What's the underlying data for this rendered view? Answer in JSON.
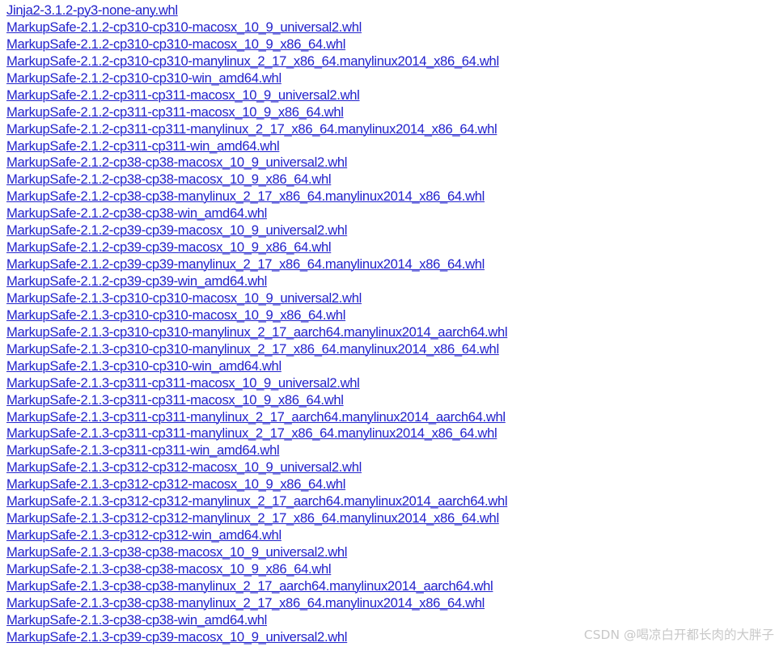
{
  "page": {
    "background_color": "#ffffff",
    "link_color": "#2222cc",
    "watermark_color": "#c8c8c8"
  },
  "watermark": {
    "text": "CSDN @喝凉白开都长肉的大胖子"
  },
  "file_index": {
    "items": [
      {
        "name": "Jinja2-3.1.2-py3-none-any.whl"
      },
      {
        "name": "MarkupSafe-2.1.2-cp310-cp310-macosx_10_9_universal2.whl"
      },
      {
        "name": "MarkupSafe-2.1.2-cp310-cp310-macosx_10_9_x86_64.whl"
      },
      {
        "name": "MarkupSafe-2.1.2-cp310-cp310-manylinux_2_17_x86_64.manylinux2014_x86_64.whl"
      },
      {
        "name": "MarkupSafe-2.1.2-cp310-cp310-win_amd64.whl"
      },
      {
        "name": "MarkupSafe-2.1.2-cp311-cp311-macosx_10_9_universal2.whl"
      },
      {
        "name": "MarkupSafe-2.1.2-cp311-cp311-macosx_10_9_x86_64.whl"
      },
      {
        "name": "MarkupSafe-2.1.2-cp311-cp311-manylinux_2_17_x86_64.manylinux2014_x86_64.whl"
      },
      {
        "name": "MarkupSafe-2.1.2-cp311-cp311-win_amd64.whl"
      },
      {
        "name": "MarkupSafe-2.1.2-cp38-cp38-macosx_10_9_universal2.whl"
      },
      {
        "name": "MarkupSafe-2.1.2-cp38-cp38-macosx_10_9_x86_64.whl"
      },
      {
        "name": "MarkupSafe-2.1.2-cp38-cp38-manylinux_2_17_x86_64.manylinux2014_x86_64.whl"
      },
      {
        "name": "MarkupSafe-2.1.2-cp38-cp38-win_amd64.whl"
      },
      {
        "name": "MarkupSafe-2.1.2-cp39-cp39-macosx_10_9_universal2.whl"
      },
      {
        "name": "MarkupSafe-2.1.2-cp39-cp39-macosx_10_9_x86_64.whl"
      },
      {
        "name": "MarkupSafe-2.1.2-cp39-cp39-manylinux_2_17_x86_64.manylinux2014_x86_64.whl"
      },
      {
        "name": "MarkupSafe-2.1.2-cp39-cp39-win_amd64.whl"
      },
      {
        "name": "MarkupSafe-2.1.3-cp310-cp310-macosx_10_9_universal2.whl"
      },
      {
        "name": "MarkupSafe-2.1.3-cp310-cp310-macosx_10_9_x86_64.whl"
      },
      {
        "name": "MarkupSafe-2.1.3-cp310-cp310-manylinux_2_17_aarch64.manylinux2014_aarch64.whl"
      },
      {
        "name": "MarkupSafe-2.1.3-cp310-cp310-manylinux_2_17_x86_64.manylinux2014_x86_64.whl"
      },
      {
        "name": "MarkupSafe-2.1.3-cp310-cp310-win_amd64.whl"
      },
      {
        "name": "MarkupSafe-2.1.3-cp311-cp311-macosx_10_9_universal2.whl"
      },
      {
        "name": "MarkupSafe-2.1.3-cp311-cp311-macosx_10_9_x86_64.whl"
      },
      {
        "name": "MarkupSafe-2.1.3-cp311-cp311-manylinux_2_17_aarch64.manylinux2014_aarch64.whl"
      },
      {
        "name": "MarkupSafe-2.1.3-cp311-cp311-manylinux_2_17_x86_64.manylinux2014_x86_64.whl"
      },
      {
        "name": "MarkupSafe-2.1.3-cp311-cp311-win_amd64.whl"
      },
      {
        "name": "MarkupSafe-2.1.3-cp312-cp312-macosx_10_9_universal2.whl"
      },
      {
        "name": "MarkupSafe-2.1.3-cp312-cp312-macosx_10_9_x86_64.whl"
      },
      {
        "name": "MarkupSafe-2.1.3-cp312-cp312-manylinux_2_17_aarch64.manylinux2014_aarch64.whl"
      },
      {
        "name": "MarkupSafe-2.1.3-cp312-cp312-manylinux_2_17_x86_64.manylinux2014_x86_64.whl"
      },
      {
        "name": "MarkupSafe-2.1.3-cp312-cp312-win_amd64.whl"
      },
      {
        "name": "MarkupSafe-2.1.3-cp38-cp38-macosx_10_9_universal2.whl"
      },
      {
        "name": "MarkupSafe-2.1.3-cp38-cp38-macosx_10_9_x86_64.whl"
      },
      {
        "name": "MarkupSafe-2.1.3-cp38-cp38-manylinux_2_17_aarch64.manylinux2014_aarch64.whl"
      },
      {
        "name": "MarkupSafe-2.1.3-cp38-cp38-manylinux_2_17_x86_64.manylinux2014_x86_64.whl"
      },
      {
        "name": "MarkupSafe-2.1.3-cp38-cp38-win_amd64.whl"
      },
      {
        "name": "MarkupSafe-2.1.3-cp39-cp39-macosx_10_9_universal2.whl"
      }
    ]
  }
}
